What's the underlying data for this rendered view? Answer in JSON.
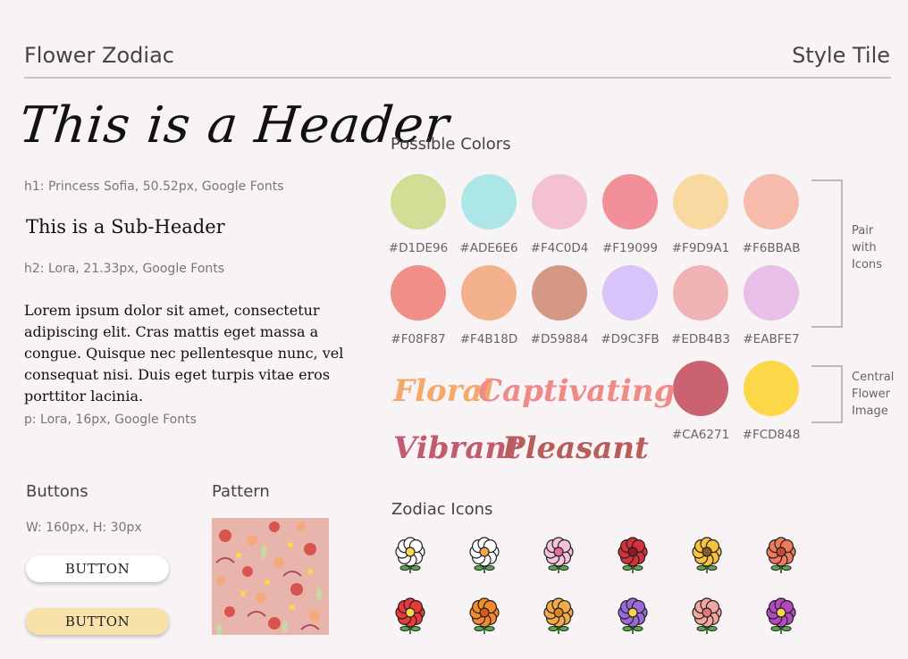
{
  "header": {
    "title": "Flower Zodiac",
    "right": "Style Tile"
  },
  "typography": {
    "h1_sample": "This is a Header",
    "h1_caption": "h1: Princess Sofia, 50.52px, Google Fonts",
    "h2_sample": "This is a Sub-Header",
    "h2_caption": "h2: Lora, 21.33px, Google Fonts",
    "paragraph": "Lorem ipsum dolor sit amet, consectetur adipiscing elit. Cras mattis eget massa a congue. Quisque nec pellentesque nunc, vel consequat nisi. Duis eget turpis vitae eros porttitor lacinia.",
    "p_caption": "p: Lora, 16px, Google Fonts"
  },
  "buttons": {
    "title": "Buttons",
    "size": "W: 160px, H: 30px",
    "primary_label": "BUTTON",
    "secondary_label": "BUTTON",
    "primary_color": "#FFFFFF",
    "secondary_color": "#F9E2A9"
  },
  "pattern": {
    "title": "Pattern"
  },
  "colors": {
    "title": "Possible Colors",
    "row1": [
      "#D1DE96",
      "#ADE6E6",
      "#F4C0D4",
      "#F19099",
      "#F9D9A1",
      "#F6BBAB"
    ],
    "row2": [
      "#F08F87",
      "#F4B18D",
      "#D59884",
      "#D9C3FB",
      "#EDB4B3",
      "#EABFE7"
    ],
    "central": [
      "#CA6271",
      "#FCD848"
    ],
    "pair_label": "Pair with Icons",
    "central_label": "Central Flower Image"
  },
  "words": {
    "floral": "Floral",
    "captivating": "Captivating",
    "vibrant": "Vibrant",
    "pleasant": "Pleasant"
  },
  "zodiac": {
    "title": "Zodiac Icons",
    "icons_row1": [
      "narcissus-icon",
      "daisy-icon",
      "lily-icon",
      "rose-icon",
      "sunflower-icon",
      "poppy-icon"
    ],
    "icons_row2": [
      "red-poppy-icon",
      "marigold-icon",
      "chrysanthemum-icon",
      "pansy-icon",
      "carnation-icon",
      "orchid-icon"
    ]
  }
}
